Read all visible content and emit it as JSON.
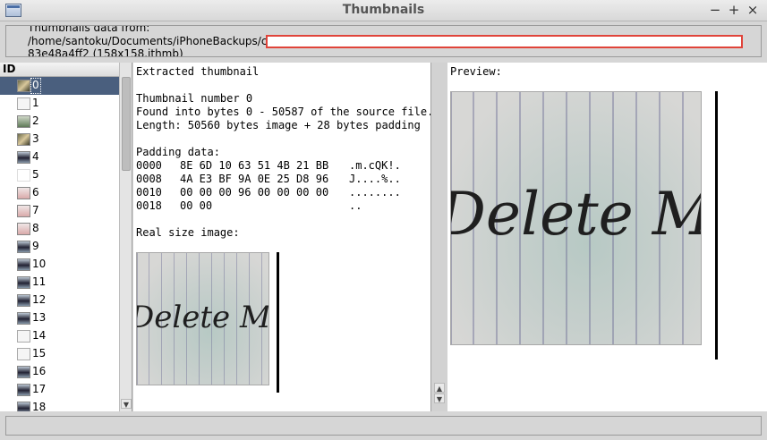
{
  "window": {
    "title": "Thumbnails",
    "minimize_label": "−",
    "maximize_label": "+",
    "close_label": "×"
  },
  "header": {
    "line1": "Thumbnails data from:",
    "line2": "/home/santoku/Documents/iPhoneBackups/c",
    "line3": "83e48a4ff2 (158x158.ithmb)",
    "path_value": ""
  },
  "list": {
    "column_header": "ID",
    "items": [
      {
        "label": "0",
        "icon": "photo-thumb"
      },
      {
        "label": "1",
        "icon": "doc-thumb"
      },
      {
        "label": "2",
        "icon": "green-thumb"
      },
      {
        "label": "3",
        "icon": "photo-thumb"
      },
      {
        "label": "4",
        "icon": "dark-thumb"
      },
      {
        "label": "5",
        "icon": "blank-thumb"
      },
      {
        "label": "6",
        "icon": "pink-thumb"
      },
      {
        "label": "7",
        "icon": "pink-thumb"
      },
      {
        "label": "8",
        "icon": "pink-thumb"
      },
      {
        "label": "9",
        "icon": "dark-thumb"
      },
      {
        "label": "10",
        "icon": "dark-thumb"
      },
      {
        "label": "11",
        "icon": "dark-thumb"
      },
      {
        "label": "12",
        "icon": "dark-thumb"
      },
      {
        "label": "13",
        "icon": "dark-thumb"
      },
      {
        "label": "14",
        "icon": "doc-thumb"
      },
      {
        "label": "15",
        "icon": "doc-thumb"
      },
      {
        "label": "16",
        "icon": "dark-thumb"
      },
      {
        "label": "17",
        "icon": "dark-thumb"
      },
      {
        "label": "18",
        "icon": "dark-thumb"
      }
    ],
    "selected_index": 0
  },
  "details": {
    "heading": "Extracted thumbnail",
    "number_line": "Thumbnail number 0",
    "found_line": "Found into bytes 0 - 50587 of the source file.",
    "length_line": "Length: 50560 bytes image + 28 bytes padding",
    "padding_label": "Padding data:",
    "hex_rows": [
      {
        "offset": "0000",
        "bytes": "8E 6D 10 63 51 4B 21 BB",
        "ascii": ".m.cQK!."
      },
      {
        "offset": "0008",
        "bytes": "4A E3 BF 9A 0E 25 D8 96",
        "ascii": "J....%.."
      },
      {
        "offset": "0010",
        "bytes": "00 00 00 96 00 00 00 00",
        "ascii": "........"
      },
      {
        "offset": "0018",
        "bytes": "00 00",
        "ascii": ".."
      }
    ],
    "real_size_label": "Real size image:",
    "image_text": "Delete M"
  },
  "preview": {
    "label": "Preview:",
    "image_text": "Delete M"
  }
}
